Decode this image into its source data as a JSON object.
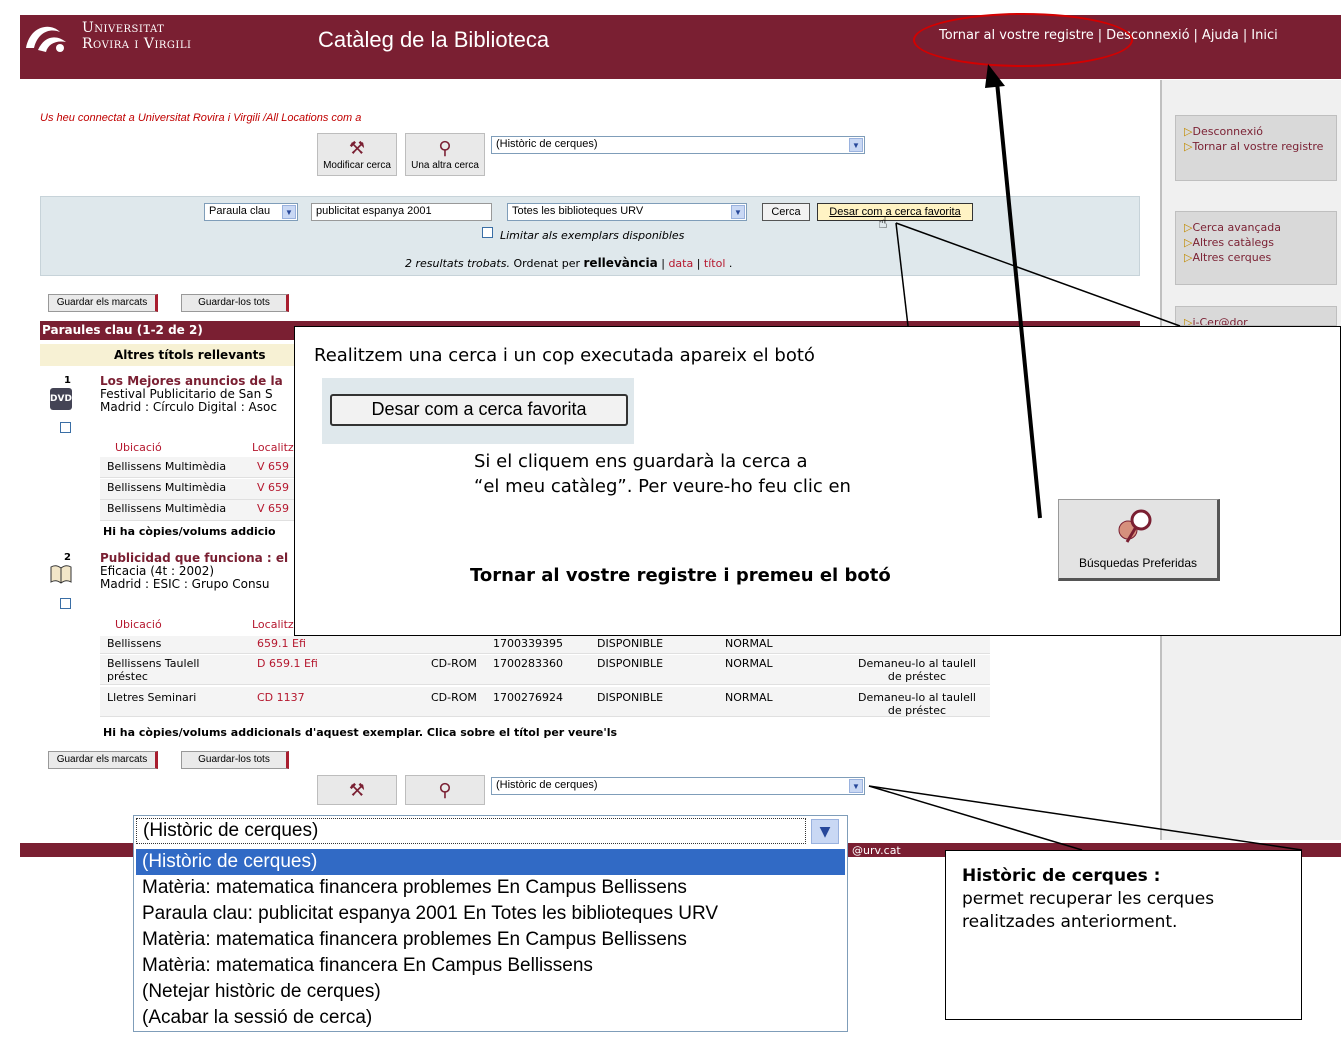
{
  "header": {
    "logo_line1": "Universitat",
    "logo_line2": "Rovira i Virgili",
    "title": "Catàleg de la Biblioteca",
    "links": [
      "Tornar al vostre registre",
      "Desconnexió",
      "Ajuda",
      "Inici"
    ]
  },
  "right_sidebar": {
    "box1": [
      "Desconnexió",
      "Tornar al vostre registre"
    ],
    "box2": [
      "Cerca avançada",
      "Altres catàlegs",
      "Altres cerques"
    ],
    "box3": [
      "i-Cer@dor"
    ]
  },
  "connected_text": "Us heu connectat a Universitat Rovira i Virgili /All Locations com a",
  "toolbar": {
    "modify_label": "Modificar cerca",
    "another_label": "Una altra cerca",
    "history_select": "(Històric de cerques)"
  },
  "search": {
    "field_select": "Paraula clau",
    "query": "publicitat espanya 2001",
    "library_select": "Totes les biblioteques URV",
    "search_button": "Cerca",
    "save_button": "Desar com a cerca favorita",
    "limit_label": "Limitar als exemplars disponibles",
    "results_found": "2 resultats trobats.",
    "ordered_by": "Ordenat per",
    "sort_relevance": "rellevància",
    "sort_date": "data",
    "sort_title": "títol"
  },
  "actions": {
    "save_marked": "Guardar els marcats",
    "save_all": "Guardar-los tots"
  },
  "results": {
    "heading": "Paraules clau (1-2 de 2)",
    "section": "Altres títols rellevants",
    "records": [
      {
        "num": "1",
        "title": "Los Mejores anuncios de la",
        "line2": "Festival Publicitario de San S",
        "line3": "Madrid : Círculo Digital : Asoc",
        "col_location": "Ubicació",
        "col_localitz": "Localitz",
        "copies": [
          {
            "location": "Bellissens Multimèdia",
            "call": "V 659"
          },
          {
            "location": "Bellissens Multimèdia",
            "call": "V 659"
          },
          {
            "location": "Bellissens Multimèdia",
            "call": "V 659"
          }
        ],
        "more": "Hi ha còpies/volums addicio"
      },
      {
        "num": "2",
        "title": "Publicidad que funciona : el",
        "line2": "Eficacia (4t : 2002)",
        "line3": "Madrid : ESIC : Grupo Consu",
        "col_location": "Ubicació",
        "col_localitz": "Localitz",
        "copies": [
          {
            "location": "Bellissens",
            "call": "659.1 Efi",
            "type": "",
            "barcode": "1700339395",
            "status": "DISPONIBLE",
            "loan": "NORMAL",
            "note": ""
          },
          {
            "location": "Bellissens Taulell préstec",
            "call": "D 659.1 Efi",
            "type": "CD-ROM",
            "barcode": "1700283360",
            "status": "DISPONIBLE",
            "loan": "NORMAL",
            "note": "Demaneu-lo al taulell de préstec"
          },
          {
            "location": "Lletres Seminari",
            "call": "CD 1137",
            "type": "CD-ROM",
            "barcode": "1700276924",
            "status": "DISPONIBLE",
            "loan": "NORMAL",
            "note": "Demaneu-lo al taulell de préstec"
          }
        ],
        "more": "Hi ha còpies/volums addicionals d'aquest exemplar. Clica sobre el títol per veure'ls"
      }
    ]
  },
  "popup": {
    "line1": "Realitzem una cerca  i un cop executada apareix el botó",
    "button": "Desar com a cerca favorita",
    "line2": "Si el cliquem ens guardarà la cerca a",
    "line3": "“el meu catàleg”. Per veure-ho feu clic en",
    "line4": "Tornar  al vostre registre i premeu el botó",
    "fav_button": "Búsquedas Preferidas"
  },
  "history_dropdown": {
    "selected": "(Històric de cerques)",
    "options": [
      "(Històric de cerques)",
      "Matèria: matematica financera problemes En Campus Bellissens",
      "Paraula clau: publicitat espanya 2001 En Totes les biblioteques URV",
      "Matèria: matematica financera problemes En Campus Bellissens",
      "Matèria: matematica financera En Campus Bellissens",
      "(Netejar històric de cerques)",
      "(Acabar la sessió de cerca)"
    ]
  },
  "footer_email": "@urv.cat",
  "history_note": {
    "title": "Històric de cerques :",
    "text": "permet recuperar les cerques realitzades anteriorment."
  },
  "colors": {
    "brand": "#7a1f32",
    "annotation_red": "#d40000",
    "selection": "#316ac5"
  }
}
